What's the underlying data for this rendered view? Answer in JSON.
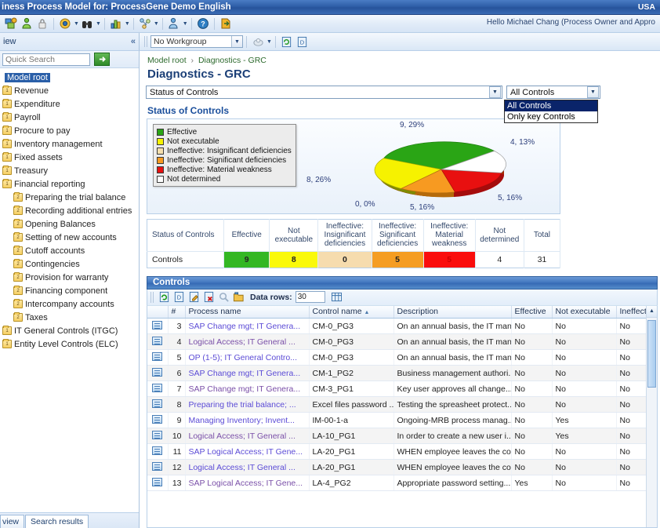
{
  "titlebar": {
    "title": "iness Process Model for: ProcessGene Demo English",
    "region": "USA"
  },
  "toolbar": {
    "greeting": "Hello Michael Chang (Process Owner and Appro",
    "buttons": [
      {
        "name": "model-tree-icon",
        "label": "Model tree"
      },
      {
        "name": "person-green-icon",
        "label": "Users"
      },
      {
        "name": "lock-icon",
        "label": "Lock"
      },
      {
        "name": "settings-gear-icon",
        "label": "Settings"
      },
      {
        "name": "binoculars-icon",
        "label": "Find"
      },
      {
        "name": "report-chart-icon",
        "label": "Reports"
      },
      {
        "name": "workflow-icon",
        "label": "Workflow"
      },
      {
        "name": "user-admin-icon",
        "label": "Administration"
      },
      {
        "name": "help-icon",
        "label": "Help"
      },
      {
        "name": "exit-icon",
        "label": "Exit"
      }
    ]
  },
  "workgroup": {
    "value": "No Workgroup",
    "options": [
      "No Workgroup"
    ]
  },
  "sidebar": {
    "panel_title": "iew",
    "search": {
      "placeholder": "Quick Search",
      "value": "",
      "go_label": "→"
    },
    "tree": [
      {
        "label": "Model root",
        "level": 1,
        "selected": true,
        "icon": "none"
      },
      {
        "label": "Revenue",
        "level": 1,
        "selected": false,
        "badge": "1"
      },
      {
        "label": "Expenditure",
        "level": 1,
        "selected": false,
        "badge": "1"
      },
      {
        "label": "Payroll",
        "level": 1,
        "selected": false,
        "badge": "1"
      },
      {
        "label": "Procure to pay",
        "level": 1,
        "selected": false,
        "badge": "1"
      },
      {
        "label": "Inventory management",
        "level": 1,
        "selected": false,
        "badge": "1"
      },
      {
        "label": "Fixed assets",
        "level": 1,
        "selected": false,
        "badge": "1"
      },
      {
        "label": "Treasury",
        "level": 1,
        "selected": false,
        "badge": "1"
      },
      {
        "label": "Financial reporting",
        "level": 1,
        "selected": false,
        "badge": "1"
      },
      {
        "label": "Preparing the trial balance",
        "level": 2,
        "selected": false,
        "badge": "2"
      },
      {
        "label": "Recording additional entries",
        "level": 2,
        "selected": false,
        "badge": "2"
      },
      {
        "label": "Opening Balances",
        "level": 2,
        "selected": false,
        "badge": "2"
      },
      {
        "label": "Setting of new accounts",
        "level": 2,
        "selected": false,
        "badge": "2"
      },
      {
        "label": "Cutoff accounts",
        "level": 2,
        "selected": false,
        "badge": "2"
      },
      {
        "label": "Contingencies",
        "level": 2,
        "selected": false,
        "badge": "2"
      },
      {
        "label": "Provision for warranty",
        "level": 2,
        "selected": false,
        "badge": "2"
      },
      {
        "label": "Financing component",
        "level": 2,
        "selected": false,
        "badge": "2"
      },
      {
        "label": "Intercompany accounts",
        "level": 2,
        "selected": false,
        "badge": "2"
      },
      {
        "label": "Taxes",
        "level": 2,
        "selected": false,
        "badge": "2"
      },
      {
        "label": "IT General Controls (ITGC)",
        "level": 1,
        "selected": false,
        "badge": "1"
      },
      {
        "label": "Entity Level Controls (ELC)",
        "level": 1,
        "selected": false,
        "badge": "1"
      }
    ],
    "bottom_tabs": [
      {
        "label": "view",
        "active": false
      },
      {
        "label": "Search results",
        "active": true
      }
    ]
  },
  "breadcrumb": {
    "root": "Model root",
    "separator": "›",
    "current": "Diagnostics - GRC"
  },
  "page": {
    "title": "Diagnostics - GRC"
  },
  "filters": {
    "report_select": {
      "value": "Status of Controls"
    },
    "scope_select": {
      "value": "All Controls",
      "open": true,
      "options": [
        {
          "label": "All Controls",
          "selected": true
        },
        {
          "label": "Only key Controls",
          "selected": false
        }
      ]
    }
  },
  "chart_section": {
    "heading": "Status of Controls"
  },
  "chart_data": {
    "type": "pie",
    "title": "Status of Controls",
    "categories": [
      "Effective",
      "Not executable",
      "Ineffective: Insignificant deficiencies",
      "Ineffective: Significant deficiencies",
      "Ineffective: Material weakness",
      "Not determined"
    ],
    "values": [
      9,
      8,
      0,
      5,
      5,
      4
    ],
    "percents": [
      29,
      26,
      0,
      16,
      16,
      13
    ],
    "labels": [
      "9, 29%",
      "8, 26%",
      "0, 0%",
      "5, 16%",
      "5, 16%",
      "4, 13%"
    ],
    "colors": [
      "#2aa515",
      "#f6f200",
      "#f5dfae",
      "#f79a21",
      "#e81010",
      "#ffffff"
    ],
    "total": 31,
    "legend_position": "left",
    "grid": false
  },
  "summary_table": {
    "headers": [
      "Status of Controls",
      "Effective",
      "Not executable",
      "Ineffective: Insignificant deficiencies",
      "Ineffective: Significant deficiencies",
      "Ineffective: Material weakness",
      "Not determined",
      "Total"
    ],
    "rows": [
      {
        "label": "Controls",
        "values": [
          "9",
          "8",
          "0",
          "5",
          "5",
          "4",
          "31"
        ],
        "cell_colors": [
          "#33b723",
          "#faf90a",
          "#f6dcae",
          "#f59d22",
          "#fa0d0d",
          "",
          ""
        ]
      }
    ]
  },
  "controls_grid": {
    "panel_title": "Controls",
    "toolbar": {
      "buttons": [
        {
          "name": "refresh-icon",
          "label": "Refresh"
        },
        {
          "name": "export-icon",
          "label": "Export"
        },
        {
          "name": "edit-icon",
          "label": "Edit"
        },
        {
          "name": "delete-icon",
          "label": "Delete"
        },
        {
          "name": "search-icon",
          "label": "Search"
        },
        {
          "name": "open-folder-icon",
          "label": "Open"
        }
      ],
      "data_rows_label": "Data rows:",
      "data_rows_value": "30",
      "columns-icon": "columns-icon"
    },
    "columns": [
      "",
      "#",
      "Process name",
      "Control name",
      "Description",
      "Effective",
      "Not executable",
      "Ineffective: In"
    ],
    "sort_column": "Control name",
    "sort_direction": "asc",
    "rows": [
      {
        "idx": "3",
        "process": "SAP Change mgt; IT Genera...",
        "control": "CM-0_PG3",
        "description": "On an annual basis, the IT man...",
        "effective": "No",
        "not_executable": "No",
        "ineffective": "No"
      },
      {
        "idx": "4",
        "process": "Logical Access; IT General ...",
        "control": "CM-0_PG3",
        "description": "On an annual basis, the IT man...",
        "effective": "No",
        "not_executable": "No",
        "ineffective": "No"
      },
      {
        "idx": "5",
        "process": "OP (1-5); IT General Contro...",
        "control": "CM-0_PG3",
        "description": "On an annual basis, the IT man...",
        "effective": "No",
        "not_executable": "No",
        "ineffective": "No"
      },
      {
        "idx": "6",
        "process": "SAP Change mgt; IT Genera...",
        "control": "CM-1_PG2",
        "description": "Business management authori...",
        "effective": "No",
        "not_executable": "No",
        "ineffective": "No"
      },
      {
        "idx": "7",
        "process": "SAP Change mgt; IT Genera...",
        "control": "CM-3_PG1",
        "description": "Key user approves all change...",
        "effective": "No",
        "not_executable": "No",
        "ineffective": "No"
      },
      {
        "idx": "8",
        "process": "Preparing the trial balance; ...",
        "control": "Excel files password ...",
        "description": "Testing the spreasheet protect...",
        "effective": "No",
        "not_executable": "No",
        "ineffective": "No"
      },
      {
        "idx": "9",
        "process": "Managing Inventory; Invent...",
        "control": "IM-00-1-a",
        "description": "Ongoing-MRB process manag...",
        "effective": "No",
        "not_executable": "Yes",
        "ineffective": "No"
      },
      {
        "idx": "10",
        "process": "Logical Access; IT General ...",
        "control": "LA-10_PG1",
        "description": "In order to create a new user i...",
        "effective": "No",
        "not_executable": "Yes",
        "ineffective": "No"
      },
      {
        "idx": "11",
        "process": "SAP Logical Access; IT Gene...",
        "control": "LA-20_PG1",
        "description": "WHEN employee leaves the co...",
        "effective": "No",
        "not_executable": "No",
        "ineffective": "No"
      },
      {
        "idx": "12",
        "process": "Logical Access; IT General ...",
        "control": "LA-20_PG1",
        "description": "WHEN employee leaves the co...",
        "effective": "No",
        "not_executable": "No",
        "ineffective": "No"
      },
      {
        "idx": "13",
        "process": "SAP Logical Access; IT Gene...",
        "control": "LA-4_PG2",
        "description": "Appropriate password setting...",
        "effective": "Yes",
        "not_executable": "No",
        "ineffective": "No"
      }
    ]
  }
}
